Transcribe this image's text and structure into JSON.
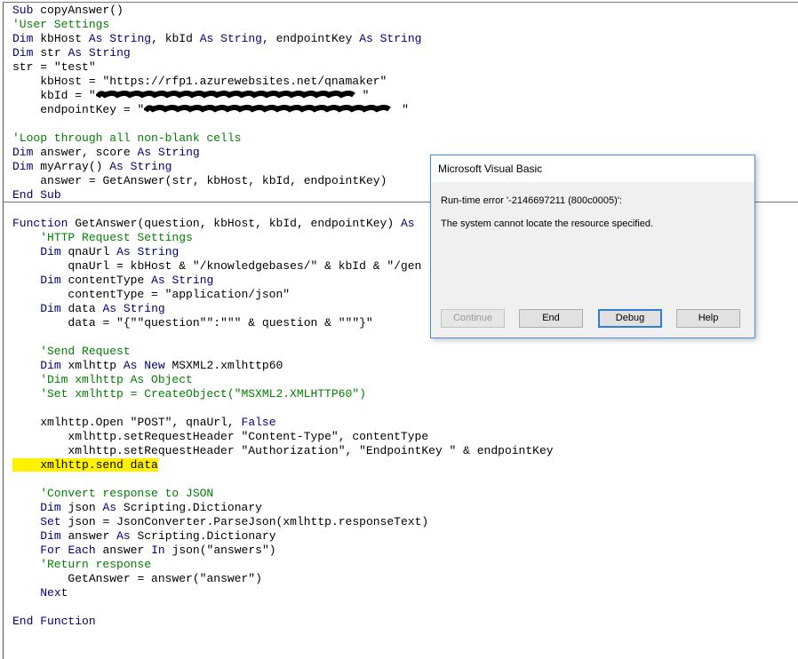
{
  "code": {
    "keywords": [
      "Sub",
      "End",
      "Function",
      "Dim",
      "As",
      "String",
      "Object",
      "New",
      "Set",
      "For",
      "Each",
      "In",
      "Next",
      "False"
    ],
    "highlight_color": "#fff200",
    "lines": [
      "Sub copyAnswer()",
      "'User Settings",
      "Dim kbHost As String, kbId As String, endpointKey As String",
      "Dim str As String",
      "str = \"test\"",
      "    kbHost = \"https://rfp1.azurewebsites.net/qnamaker\"",
      {
        "before": "    kbId = \"",
        "redacted": true,
        "after": "\""
      },
      {
        "before": "    endpointKey = \"",
        "redacted": true,
        "after": "\""
      },
      "",
      "'Loop through all non-blank cells",
      "Dim answer, score As String",
      "Dim myArray() As String",
      "    answer = GetAnswer(str, kbHost, kbId, endpointKey)",
      "End Sub",
      "",
      "Function GetAnswer(question, kbHost, kbId, endpointKey) As",
      "    'HTTP Request Settings",
      "    Dim qnaUrl As String",
      "        qnaUrl = kbHost & \"/knowledgebases/\" & kbId & \"/gen",
      "    Dim contentType As String",
      "        contentType = \"application/json\"",
      "    Dim data As String",
      "        data = \"{\"\"question\"\":\"\"\" & question & \"\"\"}\"",
      "",
      "    'Send Request",
      "    Dim xmlhttp As New MSXML2.xmlhttp60",
      "    'Dim xmlhttp As Object",
      "    'Set xmlhttp = CreateObject(\"MSXML2.XMLHTTP60\")",
      "",
      "    xmlhttp.Open \"POST\", qnaUrl, False",
      "        xmlhttp.setRequestHeader \"Content-Type\", contentType",
      "        xmlhttp.setRequestHeader \"Authorization\", \"EndpointKey \" & endpointKey",
      {
        "text": "    xmlhttp.send data",
        "highlighted": true
      },
      "",
      "    'Convert response to JSON",
      "    Dim json As Scripting.Dictionary",
      "    Set json = JsonConverter.ParseJson(xmlhttp.responseText)",
      "    Dim answer As Scripting.Dictionary",
      "    For Each answer In json(\"answers\")",
      "    'Return response",
      "        GetAnswer = answer(\"answer\")",
      "    Next",
      "",
      "End Function"
    ]
  },
  "dialog": {
    "title": "Microsoft Visual Basic",
    "error": "Run-time error '-2146697211 (800c0005)':",
    "message": "The system cannot locate the resource specified.",
    "buttons": {
      "continue": "Continue",
      "end": "End",
      "debug": "Debug",
      "help": "Help"
    }
  }
}
